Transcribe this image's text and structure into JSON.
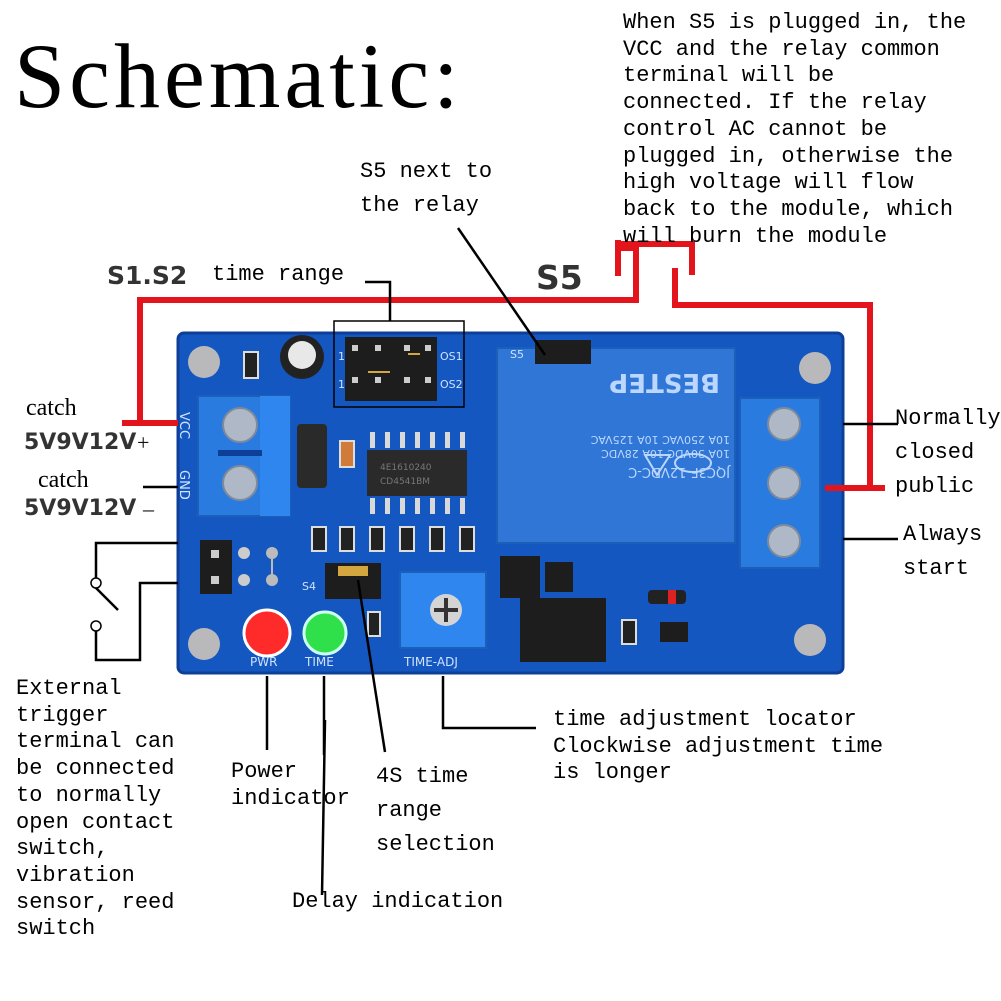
{
  "title": "Schematic:",
  "annotations": {
    "s5_warning": "When S5 is plugged in, the\nVCC and the relay common\nterminal will be\nconnected. If the relay\ncontrol AC cannot be\nplugged in, otherwise the\nhigh voltage will flow\nback to the module, which\nwill burn the module",
    "s5_location": "S5 next to\nthe relay",
    "s1s2_label": "S1.S2",
    "time_range": "time range",
    "s5_label": "S5",
    "catch_plus_label": "catch",
    "catch_plus_voltage": "5V9V12V",
    "plus_sign": "+",
    "catch_minus_label": "catch",
    "catch_minus_voltage": "5V9V12V",
    "minus_sign": "–",
    "normally_closed": "Normally\nclosed\npublic",
    "always_start": "Always\nstart",
    "external_trigger": "External\ntrigger\nterminal can\nbe connected\nto normally\nopen contact\nswitch,\nvibration\nsensor, reed\nswitch",
    "power_indicator": "Power\nindicator",
    "delay_indication": "Delay indication",
    "range_selection": "4S time\nrange\nselection",
    "time_adjust": "time adjustment locator\nClockwise adjustment time\nis longer"
  },
  "board": {
    "vcc": "VCC",
    "gnd": "GND",
    "pwr": "PWR",
    "time": "TIME",
    "time_adj": "TIME-ADJ",
    "s4": "S4",
    "s5": "S5",
    "os1": "OS1",
    "os2": "OS2",
    "jumper_pin1a": "1",
    "jumper_pin1b": "1",
    "ic_line1": "4E1610240",
    "ic_line2": "CD4541BM",
    "relay_model": "JQC3F-12VDC-C",
    "relay_rating1": "10A 30VDC 10A 28VDC",
    "relay_rating2": "10A 250VAC 10A 125VAC",
    "relay_brand": "BESTEP",
    "relay_cert": "CQC"
  },
  "colors": {
    "board": "#1557c0",
    "board_dark": "#0d3f99",
    "terminal": "#2a7be0",
    "relay": "#2f76d6",
    "wire_red": "#e3141b",
    "led_red": "#ff2a2a",
    "led_green": "#2fe04a"
  }
}
